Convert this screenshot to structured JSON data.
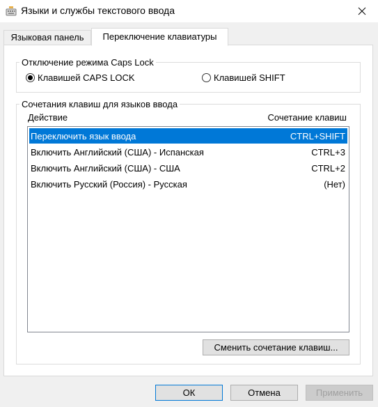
{
  "window": {
    "title": "Языки и службы текстового ввода",
    "app_icon": "keyboard-icon",
    "close_icon": "close-icon"
  },
  "tabs": [
    {
      "label": "Языковая панель",
      "active": false
    },
    {
      "label": "Переключение клавиатуры",
      "active": true
    }
  ],
  "caps_lock_group": {
    "title": "Отключение режима Caps Lock",
    "options": [
      {
        "label": "Клавишей CAPS LOCK",
        "checked": true
      },
      {
        "label": "Клавишей SHIFT",
        "checked": false
      }
    ]
  },
  "hotkeys_group": {
    "title": "Сочетания клавиш для языков ввода",
    "columns": {
      "action": "Действие",
      "keys": "Сочетание клавиш"
    },
    "rows": [
      {
        "action": "Переключить язык ввода",
        "keys": "CTRL+SHIFT",
        "selected": true
      },
      {
        "action": "Включить Английский (США) - Испанская",
        "keys": "CTRL+3",
        "selected": false
      },
      {
        "action": "Включить Английский (США) - США",
        "keys": "CTRL+2",
        "selected": false
      },
      {
        "action": "Включить Русский (Россия) - Русская",
        "keys": "(Нет)",
        "selected": false
      }
    ],
    "change_button": "Сменить сочетание клавиш..."
  },
  "footer": {
    "ok": "ОК",
    "cancel": "Отмена",
    "apply": "Применить"
  },
  "colors": {
    "selection": "#0078d7",
    "window_bg": "#f0f0f0"
  }
}
